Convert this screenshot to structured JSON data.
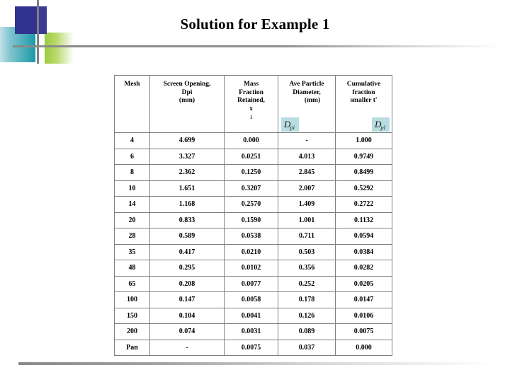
{
  "slide": {
    "title": "Solution for Example 1",
    "background_color": "#ffffff",
    "decoration": {
      "navy_color": "#333391",
      "teal_color": "#1a9aa8",
      "green_color": "#9bcc3c",
      "rule_color": "#8a8a8a"
    }
  },
  "table": {
    "headers": [
      {
        "lines": [
          "Mesh"
        ]
      },
      {
        "lines": [
          "Screen Opening,",
          "Dpi",
          "(mm)"
        ]
      },
      {
        "lines": [
          "Mass",
          "Fraction",
          "Retained,"
        ],
        "subscript_label": "x",
        "subscript": "i"
      },
      {
        "lines": [
          "(mm)"
        ],
        "equation": {
          "base": "D",
          "sub": "pi",
          "overbar": true,
          "highlight": "#b8dde0"
        }
      },
      {
        "lines": [
          "Cumulative",
          "fraction",
          "smaller t'"
        ],
        "equation": {
          "base": "D",
          "sub": "pl",
          "overbar": false,
          "highlight": "#b8dde0"
        }
      }
    ],
    "header_titles": [
      "Mesh",
      "Screen Opening, Dpi (mm)",
      "Mass Fraction Retained, xi",
      "Ave Particle Diameter, Dpi (mm)",
      "Cumulative fraction smaller t' Dpl"
    ],
    "header_col3_extra": [
      "Ave Particle",
      "Diameter,"
    ],
    "rows": [
      {
        "mesh": "4",
        "screen_opening": "4.699",
        "mass_fraction": "0.000",
        "ave_diameter": "-",
        "cumulative": "1.000"
      },
      {
        "mesh": "6",
        "screen_opening": "3.327",
        "mass_fraction": "0.0251",
        "ave_diameter": "4.013",
        "cumulative": "0.9749"
      },
      {
        "mesh": "8",
        "screen_opening": "2.362",
        "mass_fraction": "0.1250",
        "ave_diameter": "2.845",
        "cumulative": "0.8499"
      },
      {
        "mesh": "10",
        "screen_opening": "1.651",
        "mass_fraction": "0.3207",
        "ave_diameter": "2.007",
        "cumulative": "0.5292"
      },
      {
        "mesh": "14",
        "screen_opening": "1.168",
        "mass_fraction": "0.2570",
        "ave_diameter": "1.409",
        "cumulative": "0.2722"
      },
      {
        "mesh": "20",
        "screen_opening": "0.833",
        "mass_fraction": "0.1590",
        "ave_diameter": "1.001",
        "cumulative": "0.1132"
      },
      {
        "mesh": "28",
        "screen_opening": "0.589",
        "mass_fraction": "0.0538",
        "ave_diameter": "0.711",
        "cumulative": "0.0594"
      },
      {
        "mesh": "35",
        "screen_opening": "0.417",
        "mass_fraction": "0.0210",
        "ave_diameter": "0.503",
        "cumulative": "0.0384"
      },
      {
        "mesh": "48",
        "screen_opening": "0.295",
        "mass_fraction": "0.0102",
        "ave_diameter": "0.356",
        "cumulative": "0.0282"
      },
      {
        "mesh": "65",
        "screen_opening": "0.208",
        "mass_fraction": "0.0077",
        "ave_diameter": "0.252",
        "cumulative": "0.0205"
      },
      {
        "mesh": "100",
        "screen_opening": "0.147",
        "mass_fraction": "0.0058",
        "ave_diameter": "0.178",
        "cumulative": "0.0147"
      },
      {
        "mesh": "150",
        "screen_opening": "0.104",
        "mass_fraction": "0.0041",
        "ave_diameter": "0.126",
        "cumulative": "0.0106"
      },
      {
        "mesh": "200",
        "screen_opening": "0.074",
        "mass_fraction": "0.0031",
        "ave_diameter": "0.089",
        "cumulative": "0.0075"
      },
      {
        "mesh": "Pan",
        "screen_opening": "-",
        "mass_fraction": "0.0075",
        "ave_diameter": "0.037",
        "cumulative": "0.000"
      }
    ]
  }
}
